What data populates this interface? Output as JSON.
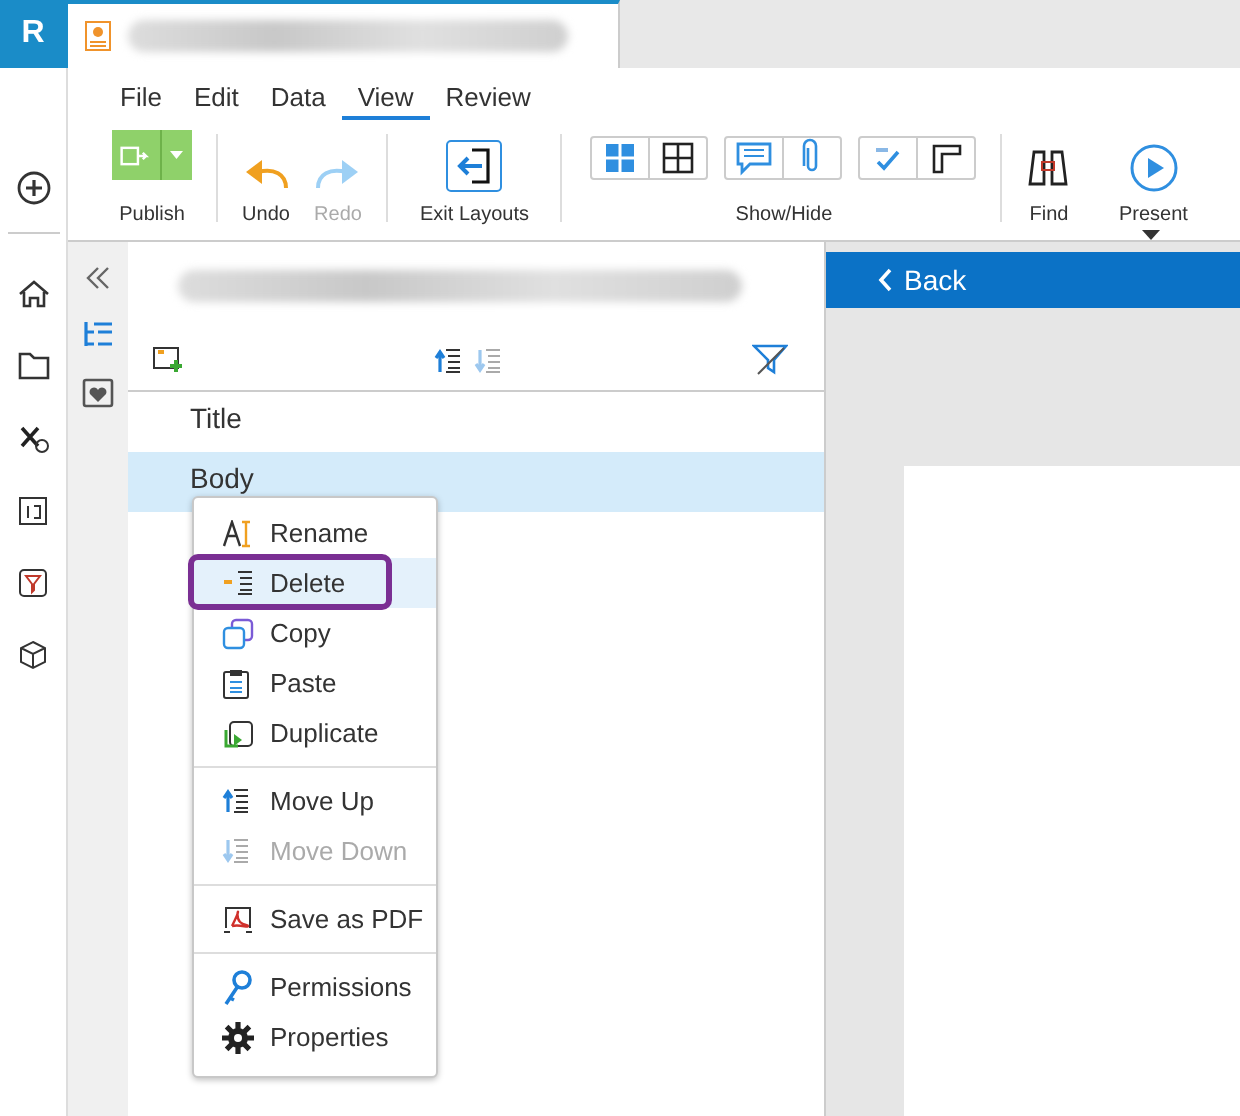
{
  "app_badge": "R",
  "menu": [
    {
      "label": "File",
      "selected": false
    },
    {
      "label": "Edit",
      "selected": false
    },
    {
      "label": "Data",
      "selected": false
    },
    {
      "label": "View",
      "selected": true
    },
    {
      "label": "Review",
      "selected": false
    }
  ],
  "ribbon": {
    "publish": "Publish",
    "undo": {
      "label": "Undo",
      "disabled": false
    },
    "redo": {
      "label": "Redo",
      "disabled": true
    },
    "exit_layouts": "Exit Layouts",
    "show_hide": "Show/Hide",
    "find": "Find",
    "present": "Present"
  },
  "outline": {
    "items": [
      {
        "label": "Title",
        "selected": false
      },
      {
        "label": "Body",
        "selected": true
      }
    ]
  },
  "back_button": "Back",
  "context_menu": [
    {
      "kind": "item",
      "label": "Rename",
      "selected": false,
      "disabled": false
    },
    {
      "kind": "item",
      "label": "Delete",
      "selected": true,
      "disabled": false
    },
    {
      "kind": "item",
      "label": "Copy",
      "selected": false,
      "disabled": false
    },
    {
      "kind": "item",
      "label": "Paste",
      "selected": false,
      "disabled": false
    },
    {
      "kind": "item",
      "label": "Duplicate",
      "selected": false,
      "disabled": false
    },
    {
      "kind": "separator"
    },
    {
      "kind": "item",
      "label": "Move Up",
      "selected": false,
      "disabled": false
    },
    {
      "kind": "item",
      "label": "Move Down",
      "selected": false,
      "disabled": true
    },
    {
      "kind": "separator"
    },
    {
      "kind": "item",
      "label": "Save as PDF",
      "selected": false,
      "disabled": false
    },
    {
      "kind": "separator"
    },
    {
      "kind": "item",
      "label": "Permissions",
      "selected": false,
      "disabled": false
    },
    {
      "kind": "item",
      "label": "Properties",
      "selected": false,
      "disabled": false
    }
  ]
}
